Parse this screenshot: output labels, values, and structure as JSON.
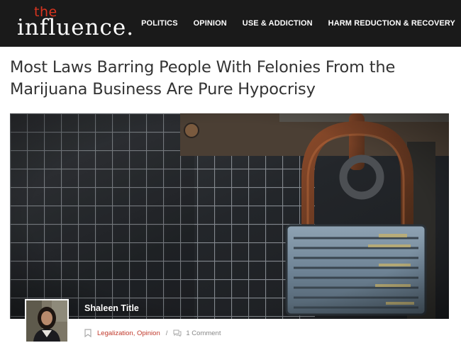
{
  "header": {
    "logo": {
      "small": "the",
      "main": "influence."
    },
    "nav": [
      {
        "label": "POLITICS"
      },
      {
        "label": "OPINION"
      },
      {
        "label": "USE & ADDICTION"
      },
      {
        "label": "HARM REDUCTION & RECOVERY"
      }
    ]
  },
  "article": {
    "title": "Most Laws Barring People With Felonies From the Marijuana Business Are Pure Hypocrisy",
    "hero_image": "rusty-padlock-on-wire-grate",
    "author": "Shaleen Title",
    "categories": [
      "Legalization",
      "Opinion"
    ],
    "categories_text": "Legalization, Opinion",
    "separator": "/",
    "comments": "1 Comment"
  },
  "colors": {
    "header_bg": "#1a1a1a",
    "accent": "#d9341f",
    "category_link": "#c0392b"
  }
}
